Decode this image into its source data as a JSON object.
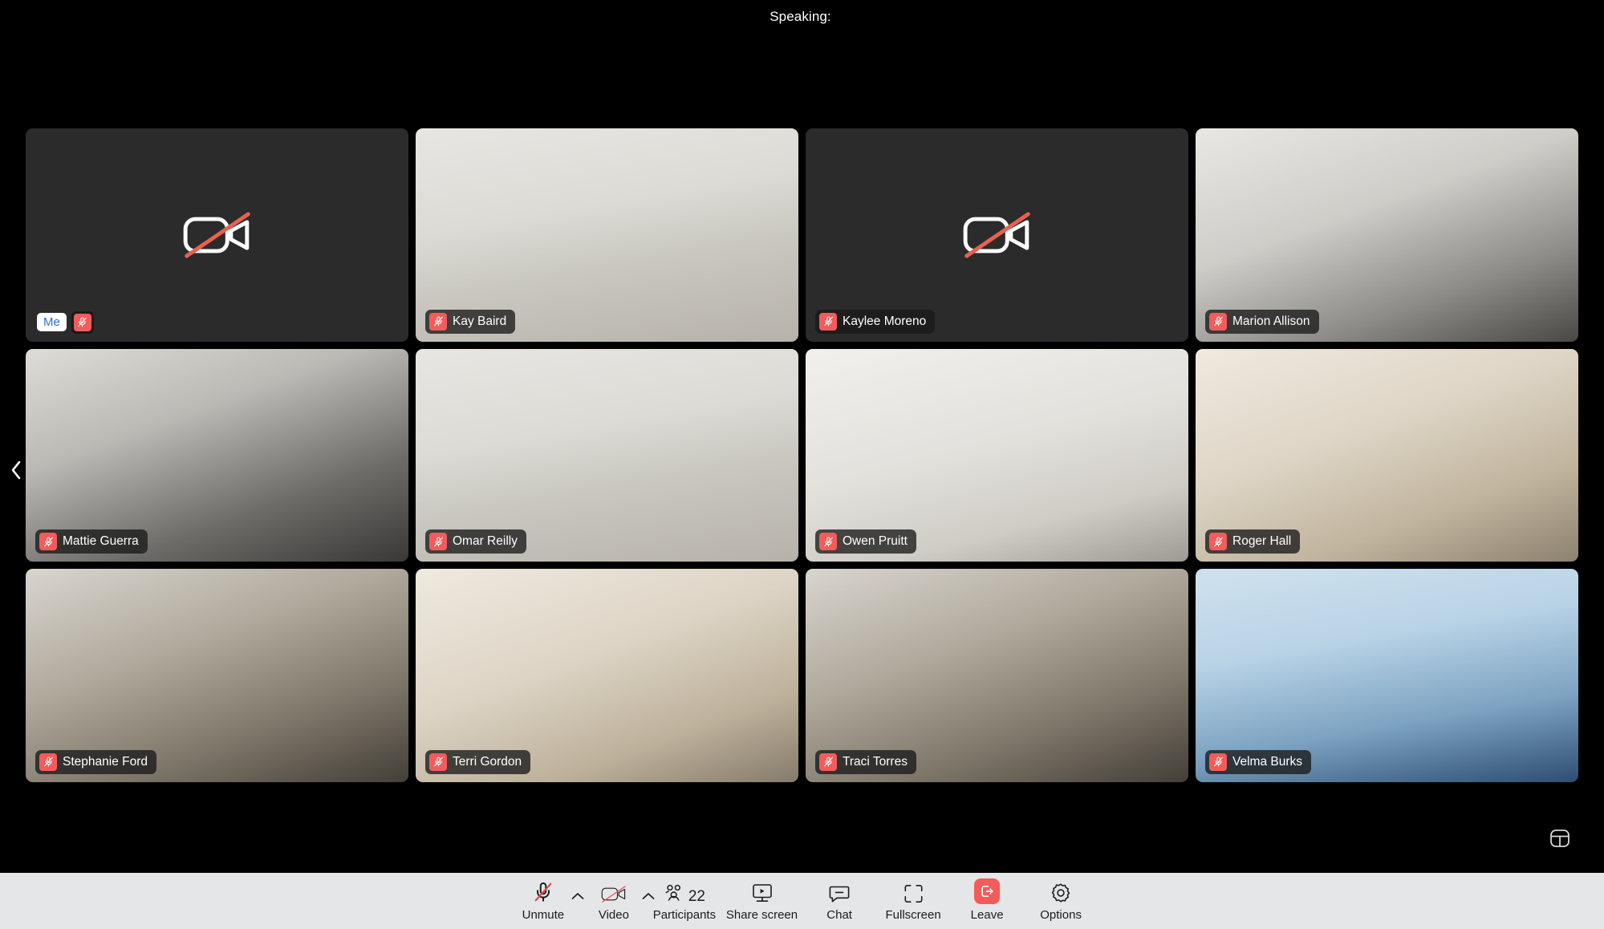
{
  "header": {
    "speaking_label": "Speaking:",
    "speaking_names": ""
  },
  "colors": {
    "page_background": "#000000",
    "tile_placeholder": "#2b2b2b",
    "toolbar_background": "#e5e6e8",
    "accent_red": "#f45b5b",
    "me_text_blue": "#2d6cdf",
    "badge_background": "rgba(26,26,26,0.78)"
  },
  "gallery": {
    "columns": 4,
    "rows": 3,
    "tiles": [
      {
        "name": "Me",
        "is_me": true,
        "muted": true,
        "camera_off": true,
        "icon": "camera-off-icon"
      },
      {
        "name": "Kay Baird",
        "is_me": false,
        "muted": true,
        "camera_off": false,
        "icon": "mic-off-icon"
      },
      {
        "name": "Kaylee Moreno",
        "is_me": false,
        "muted": true,
        "camera_off": true,
        "icon": "camera-off-icon"
      },
      {
        "name": "Marion Allison",
        "is_me": false,
        "muted": true,
        "camera_off": false,
        "icon": "mic-off-icon"
      },
      {
        "name": "Mattie Guerra",
        "is_me": false,
        "muted": true,
        "camera_off": false,
        "icon": "mic-off-icon"
      },
      {
        "name": "Omar Reilly",
        "is_me": false,
        "muted": true,
        "camera_off": false,
        "icon": "mic-off-icon"
      },
      {
        "name": "Owen Pruitt",
        "is_me": false,
        "muted": true,
        "camera_off": false,
        "icon": "mic-off-icon"
      },
      {
        "name": "Roger Hall",
        "is_me": false,
        "muted": true,
        "camera_off": false,
        "icon": "mic-off-icon"
      },
      {
        "name": "Stephanie Ford",
        "is_me": false,
        "muted": true,
        "camera_off": false,
        "icon": "mic-off-icon"
      },
      {
        "name": "Terri Gordon",
        "is_me": false,
        "muted": true,
        "camera_off": false,
        "icon": "mic-off-icon"
      },
      {
        "name": "Traci Torres",
        "is_me": false,
        "muted": true,
        "camera_off": false,
        "icon": "mic-off-icon"
      },
      {
        "name": "Velma Burks",
        "is_me": false,
        "muted": true,
        "camera_off": false,
        "icon": "mic-off-icon"
      }
    ]
  },
  "navigation": {
    "prev_page_icon": "chevron-left-icon",
    "view_layout_icon": "gallery-layout-icon"
  },
  "toolbar": {
    "items": [
      {
        "id": "unmute",
        "label": "Unmute",
        "icon": "mic-off-icon",
        "caret": true
      },
      {
        "id": "video",
        "label": "Video",
        "icon": "camera-off-icon",
        "caret": true
      },
      {
        "id": "participants",
        "label": "Participants",
        "icon": "participants-icon",
        "count": "22"
      },
      {
        "id": "share-screen",
        "label": "Share screen",
        "icon": "share-screen-icon"
      },
      {
        "id": "chat",
        "label": "Chat",
        "icon": "chat-icon"
      },
      {
        "id": "fullscreen",
        "label": "Fullscreen",
        "icon": "fullscreen-icon"
      },
      {
        "id": "leave",
        "label": "Leave",
        "icon": "leave-icon"
      },
      {
        "id": "options",
        "label": "Options",
        "icon": "gear-icon"
      }
    ],
    "caret_icon": "chevron-up-icon"
  }
}
